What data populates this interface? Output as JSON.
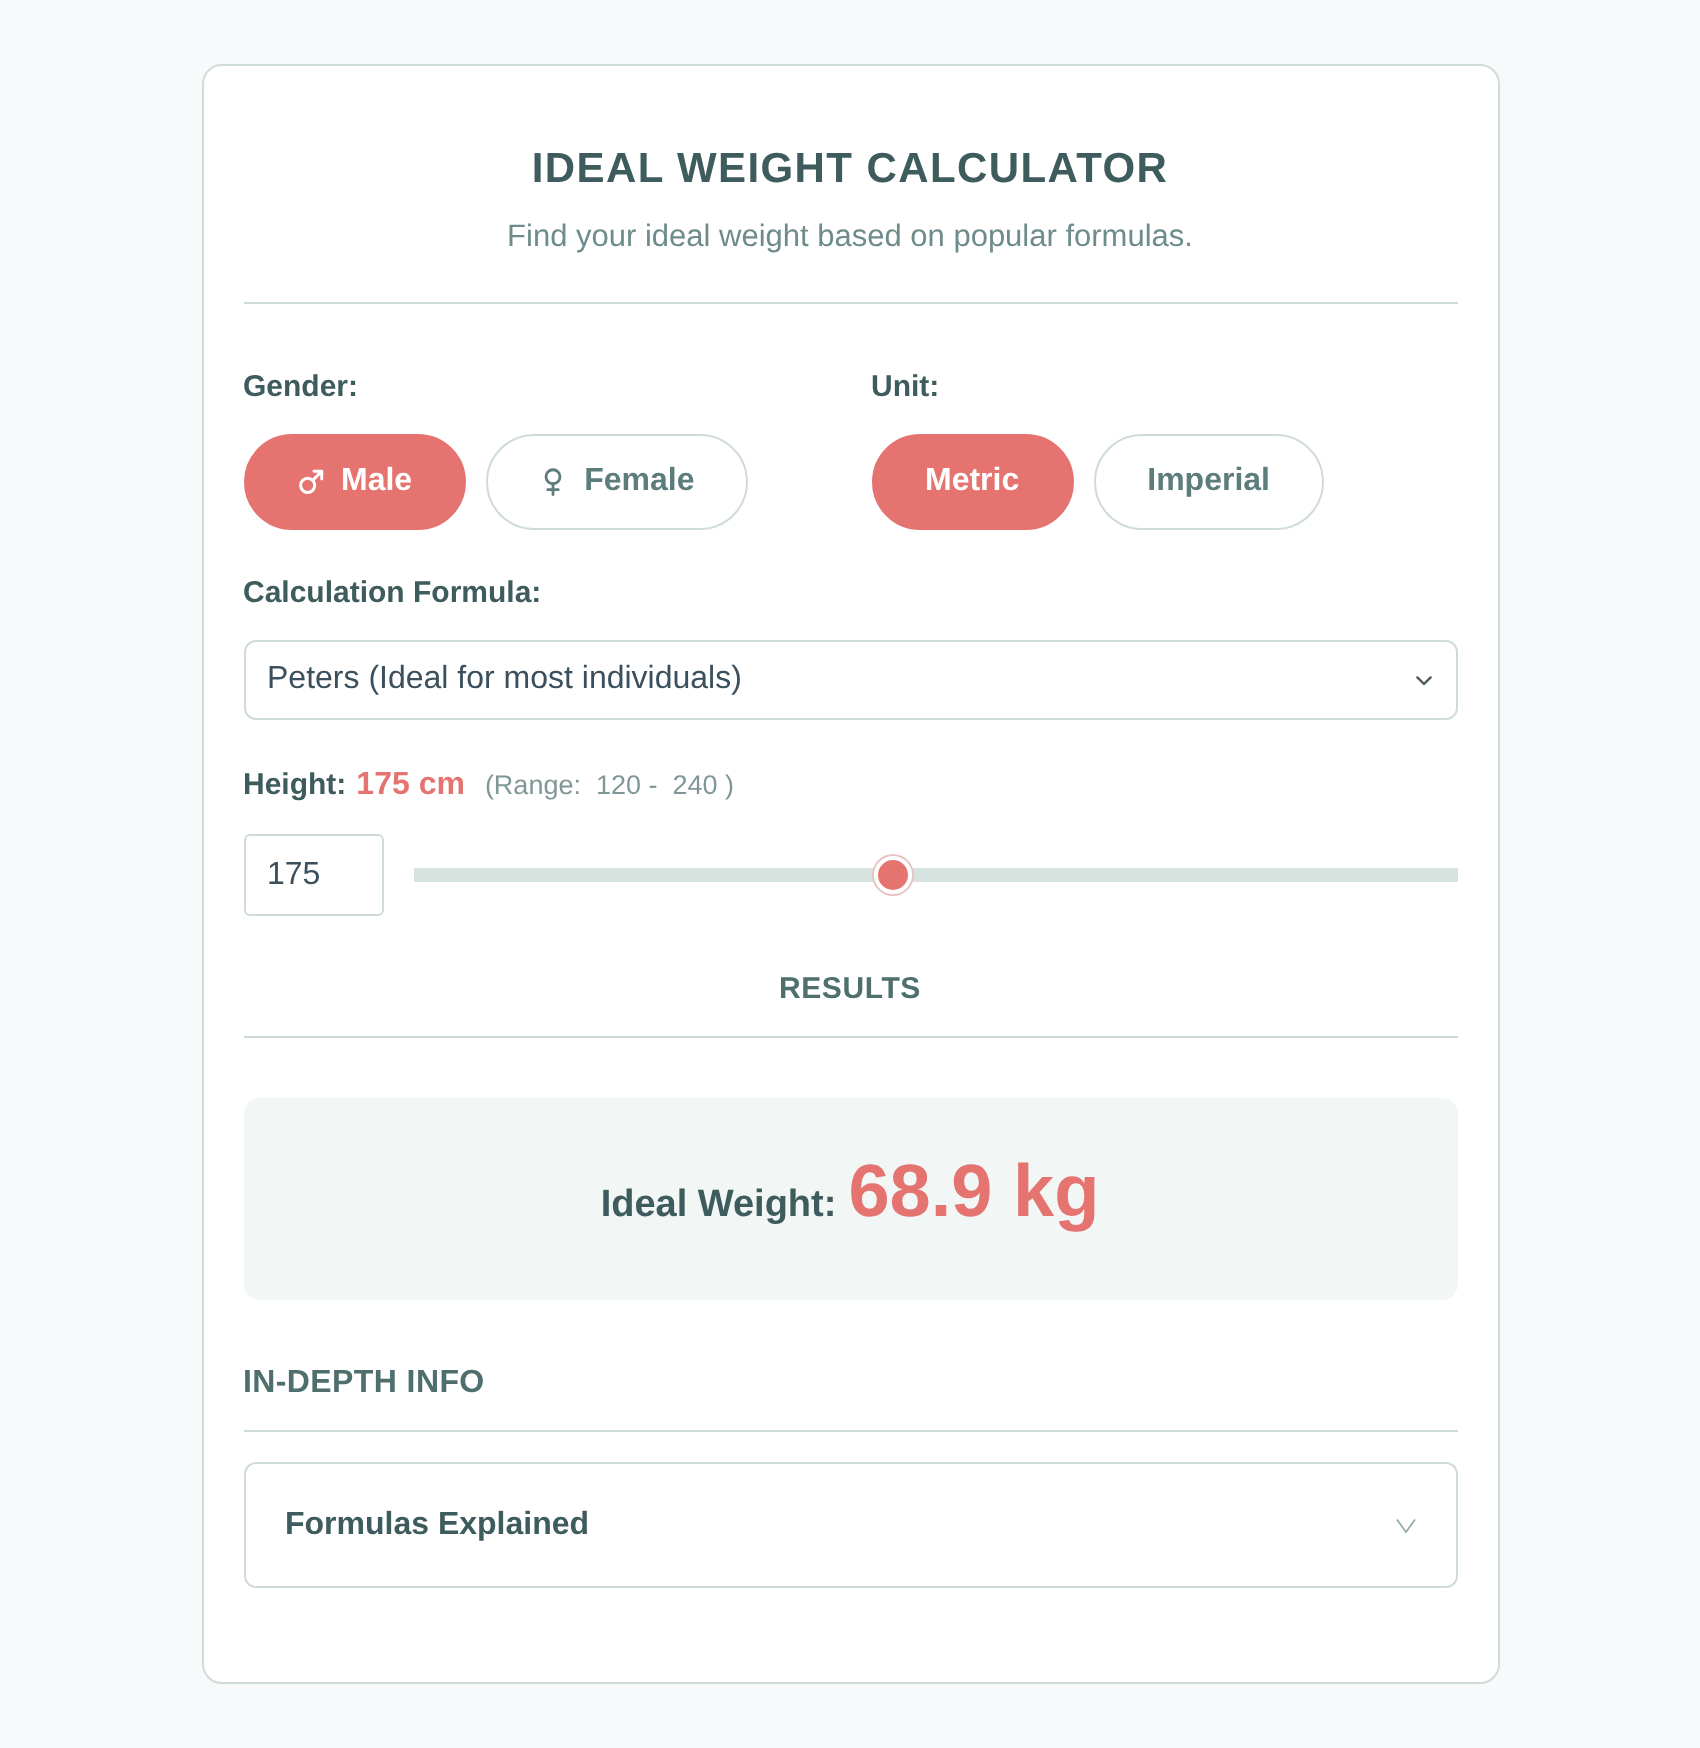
{
  "header": {
    "title": "IDEAL WEIGHT CALCULATOR",
    "subtitle": "Find your ideal weight based on popular formulas."
  },
  "gender": {
    "label": "Gender:",
    "options": [
      {
        "kind": "male",
        "label": "Male",
        "selected": true
      },
      {
        "kind": "female",
        "label": "Female",
        "selected": false
      }
    ]
  },
  "unit": {
    "label": "Unit:",
    "options": [
      {
        "label": "Metric",
        "selected": true
      },
      {
        "label": "Imperial",
        "selected": false
      }
    ]
  },
  "formula": {
    "label": "Calculation Formula:",
    "value": "Peters (Ideal for most individuals)"
  },
  "height": {
    "label": "Height:",
    "reading": "175 cm",
    "range": "(Range:  120 -  240 )",
    "value": "175",
    "level": 0.458
  },
  "results": {
    "heading": "RESULTS",
    "label": "Ideal Weight:",
    "value": "68.9 kg"
  },
  "info": {
    "heading": "IN-DEPTH INFO",
    "sections": [
      {
        "title": "Formulas Explained",
        "expanded": false
      }
    ]
  }
}
